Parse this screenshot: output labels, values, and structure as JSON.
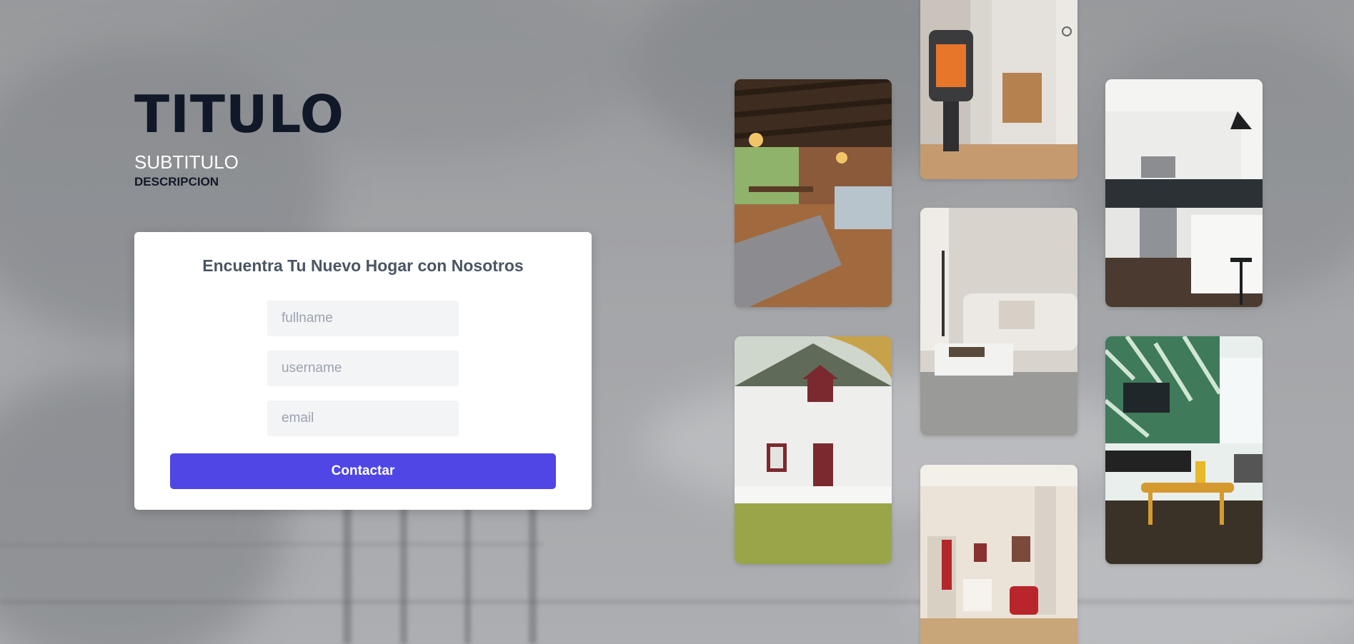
{
  "hero": {
    "title": "TITULO",
    "subtitle": "SUBTITULO",
    "description": "DESCRIPCION"
  },
  "form": {
    "heading": "Encuentra Tu Nuevo Hogar con Nosotros",
    "fields": [
      {
        "name": "fullname",
        "placeholder": "fullname",
        "value": ""
      },
      {
        "name": "username",
        "placeholder": "username",
        "value": ""
      },
      {
        "name": "email",
        "placeholder": "email",
        "value": ""
      }
    ],
    "submit_label": "Contactar"
  },
  "gallery": {
    "images": [
      {
        "name": "office-interior-photo"
      },
      {
        "name": "fireplace-stove-photo"
      },
      {
        "name": "kitchen-photo"
      },
      {
        "name": "living-room-sofa-photo"
      },
      {
        "name": "white-house-exterior-photo"
      },
      {
        "name": "tropical-wallpaper-living-room-photo"
      },
      {
        "name": "bright-living-room-photo"
      }
    ]
  },
  "colors": {
    "accent": "#4f46e5",
    "title_text": "#111827",
    "card_background": "#ffffff",
    "input_background": "#f3f4f6"
  }
}
